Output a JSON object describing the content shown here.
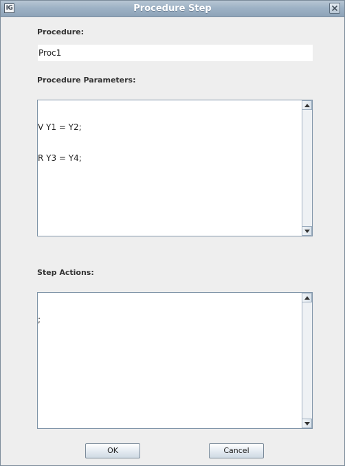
{
  "window": {
    "title": "Procedure Step",
    "app_icon_text": "IG"
  },
  "procedure": {
    "label": "Procedure:",
    "value": "Proc1"
  },
  "parameters": {
    "label": "Procedure Parameters:",
    "lines": [
      "V Y1 = Y2;",
      "R Y3 = Y4;"
    ]
  },
  "step_actions": {
    "label": "Step Actions:",
    "lines": [
      ";"
    ]
  },
  "buttons": {
    "ok_label": "OK",
    "cancel_label": "Cancel"
  },
  "icons": {
    "close": "close-icon",
    "scroll_up": "scroll-up-arrow-icon",
    "scroll_down": "scroll-down-arrow-icon"
  },
  "colors": {
    "titlebar": "#9eb2c5",
    "window_background": "#eeeeee",
    "field_background": "#ffffff"
  }
}
